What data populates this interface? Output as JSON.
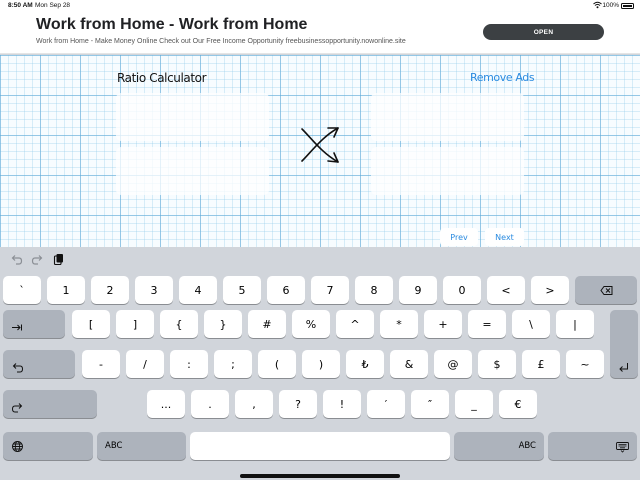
{
  "status_bar": {
    "time": "8:50 AM",
    "date": "Mon Sep 28",
    "battery": "100%"
  },
  "ad": {
    "title": "Work from Home - Work from Home",
    "description": "Work from Home - Make Money Online Check out Our Free Income Opportunity freebusinessopportunity.nowonline.site",
    "button_label": "OPEN"
  },
  "app": {
    "title": "Ratio Calculator",
    "remove_ads": "Remove Ads",
    "prev": "Prev",
    "next": "Next"
  },
  "keyboard": {
    "toolbar": [
      "undo-icon",
      "redo-icon",
      "clipboard-icon"
    ],
    "row1": [
      "`",
      "1",
      "2",
      "3",
      "4",
      "5",
      "6",
      "7",
      "8",
      "9",
      "0",
      "<",
      ">"
    ],
    "row2": [
      "[",
      "]",
      "{",
      "}",
      "#",
      "%",
      "^",
      "*",
      "+",
      "=",
      "\\",
      "|"
    ],
    "row3": [
      "-",
      "/",
      ":",
      ";",
      "(",
      ")",
      "₺",
      "&",
      "@",
      "$",
      "£",
      "~"
    ],
    "row4": [
      "...",
      ".",
      ",",
      "?",
      "!",
      "′",
      "″",
      "_",
      "€"
    ],
    "abc_left": "ABC",
    "abc_right": "ABC",
    "icons": [
      "delete-icon",
      "tab-icon",
      "undo-key-icon",
      "return-icon",
      "redo-key-icon",
      "globe-icon",
      "keyboard-dismiss-icon"
    ]
  }
}
